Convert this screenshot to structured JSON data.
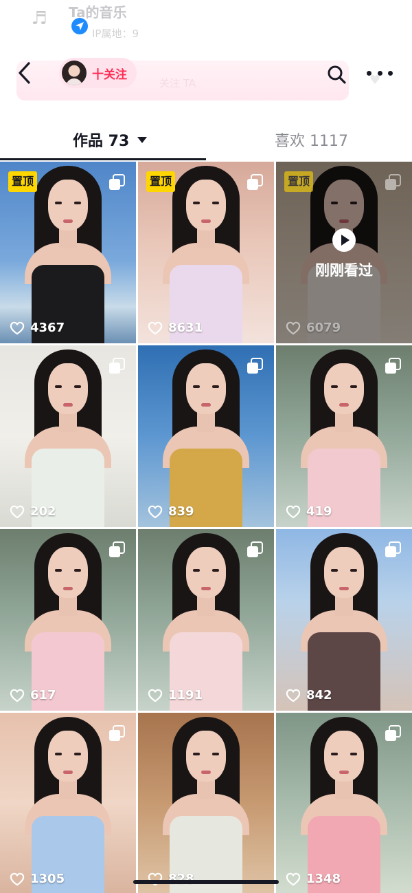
{
  "ghost_header": {
    "title": "Ta的音乐",
    "subtitle": "IP属地：9"
  },
  "top_bar": {
    "follow_label": "十关注",
    "ghost_band_text": "关注 TA"
  },
  "tabs": [
    {
      "label": "作品 73",
      "active": true,
      "has_dropdown": true
    },
    {
      "label": "喜欢 1117",
      "active": false
    }
  ],
  "tiles": [
    {
      "likes": "4367",
      "pinned": true,
      "pin_label": "置顶",
      "multi": true,
      "watched": false,
      "bg": "sky",
      "dress": "#1b1b1d"
    },
    {
      "likes": "8631",
      "pinned": true,
      "pin_label": "置顶",
      "multi": true,
      "watched": false,
      "bg": "bedroom",
      "dress": "#ead9ec"
    },
    {
      "likes": "6079",
      "pinned": true,
      "pin_label": "置顶",
      "multi": true,
      "watched": true,
      "watched_label": "刚刚看过",
      "bg": "warm",
      "dress": "#f0e8e0"
    },
    {
      "likes": "202",
      "pinned": false,
      "multi": true,
      "watched": false,
      "bg": "roses",
      "dress": "#e9efe8"
    },
    {
      "likes": "839",
      "pinned": false,
      "multi": true,
      "watched": false,
      "bg": "sea",
      "dress": "#d4a849"
    },
    {
      "likes": "419",
      "pinned": false,
      "multi": true,
      "watched": false,
      "bg": "lake",
      "dress": "#f2c9cf"
    },
    {
      "likes": "617",
      "pinned": false,
      "multi": true,
      "watched": false,
      "bg": "lake",
      "dress": "#f3c8d0"
    },
    {
      "likes": "1191",
      "pinned": false,
      "multi": true,
      "watched": false,
      "bg": "lake",
      "dress": "#f4d7d8"
    },
    {
      "likes": "842",
      "pinned": false,
      "multi": true,
      "watched": false,
      "bg": "garden",
      "dress": "#5c4646"
    },
    {
      "likes": "1305",
      "pinned": false,
      "multi": true,
      "watched": false,
      "bg": "room",
      "dress": "#a9c8ea"
    },
    {
      "likes": "828",
      "pinned": false,
      "multi": false,
      "watched": false,
      "bg": "wood",
      "dress": "#e6e7df"
    },
    {
      "likes": "1348",
      "pinned": false,
      "multi": true,
      "watched": false,
      "bg": "pond",
      "dress": "#f2a8b2"
    }
  ],
  "colors": {
    "accent": "#fe2c55",
    "pin_badge": "#ffd600",
    "location_blue": "#1e8cff"
  }
}
